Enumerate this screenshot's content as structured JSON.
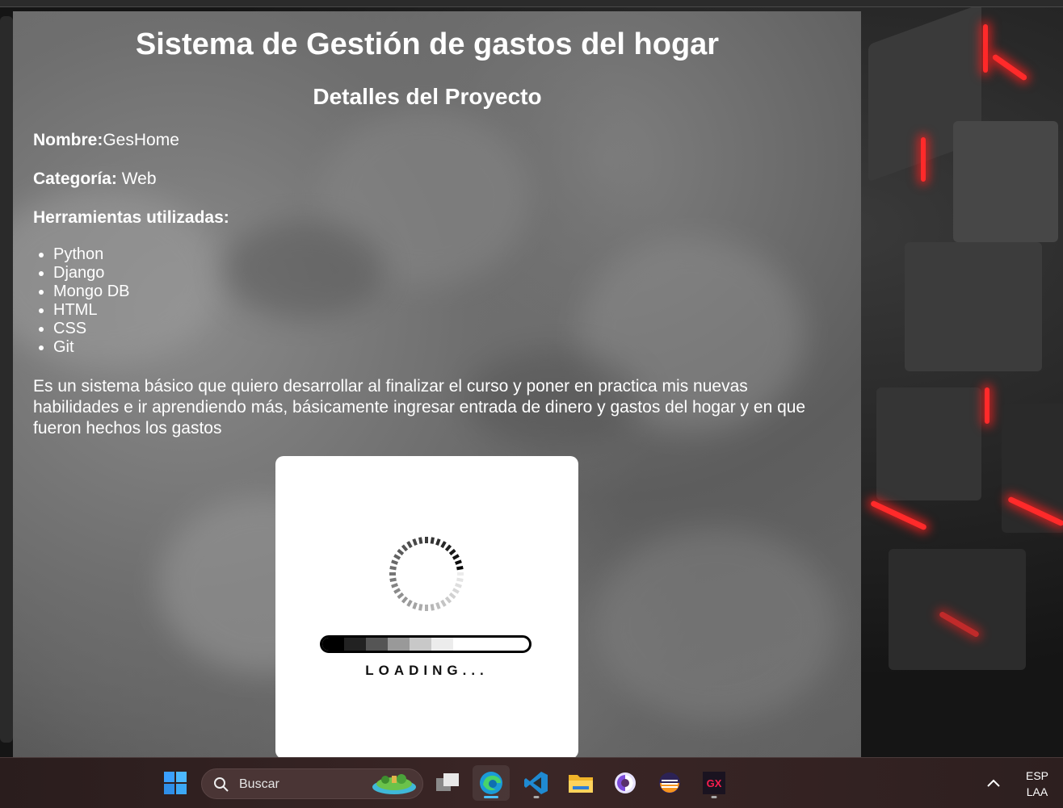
{
  "page": {
    "title": "Sistema de Gestión de gastos del hogar",
    "subtitle": "Detalles del Proyecto",
    "name_label": "Nombre:",
    "name_value": "GesHome",
    "category_label": "Categoría:",
    "category_value": " Web",
    "tools_label": "Herramientas utilizadas:",
    "tools": [
      "Python",
      "Django",
      "Mongo DB",
      "HTML",
      "CSS",
      "Git"
    ],
    "description": "Es un sistema básico que quiero desarrollar al finalizar el curso y poner en practica mis nuevas habilidades e ir aprendiendo más, básicamente ingresar entrada de dinero y gastos del hogar y en que fueron hechos los gastos",
    "loading_text": "LOADING..."
  },
  "taskbar": {
    "search_placeholder": "Buscar",
    "apps": [
      "start-icon",
      "search-icon",
      "task-view-icon",
      "edge-icon",
      "vscode-icon",
      "file-explorer-icon",
      "tor-browser-icon",
      "eclipse-icon",
      "opera-gx-icon"
    ],
    "tray_lang": "ESP",
    "tray_layout": "LAA"
  },
  "colors": {
    "accent_red": "#ff2a2a",
    "taskbar_indicator": "#4cc2ff"
  }
}
